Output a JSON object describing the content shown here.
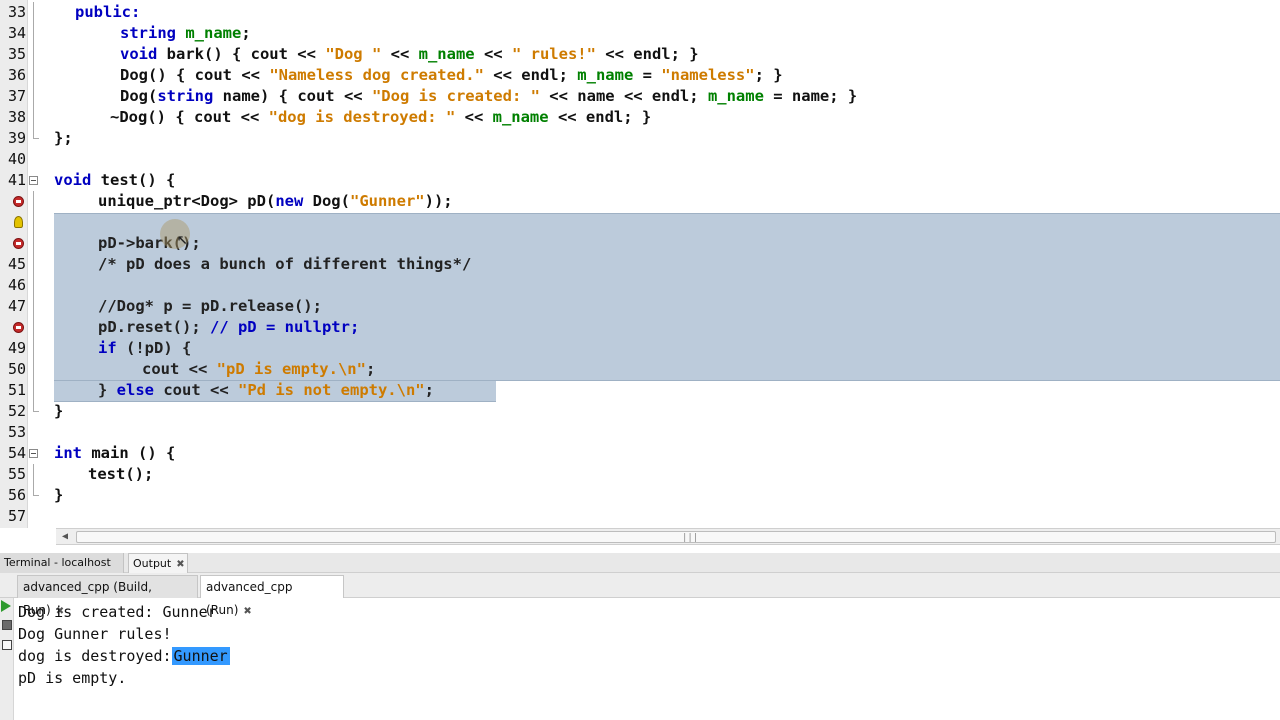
{
  "editor": {
    "lines": [
      {
        "n": "33",
        "text": "public:"
      },
      {
        "n": "34",
        "text": "string m_name;"
      },
      {
        "n": "35",
        "text": "void bark() { cout << \"Dog \" << m_name << \" rules!\" << endl; }"
      },
      {
        "n": "36",
        "text": "Dog() { cout << \"Nameless dog created.\" << endl; m_name = \"nameless\"; }"
      },
      {
        "n": "37",
        "text": "Dog(string name) { cout << \"Dog is created: \" << name << endl; m_name = name; }"
      },
      {
        "n": "38",
        "text": "~Dog() { cout << \"dog is destroyed: \" << m_name << endl; }"
      },
      {
        "n": "39",
        "text": "};"
      },
      {
        "n": "40",
        "text": ""
      },
      {
        "n": "41",
        "text": "void test() {"
      },
      {
        "n": "",
        "text": "unique_ptr<Dog> pD(new Dog(\"Gunner\"));"
      },
      {
        "n": "",
        "text": ""
      },
      {
        "n": "",
        "text": "pD->bark();"
      },
      {
        "n": "45",
        "text": "/* pD does a bunch of different things*/"
      },
      {
        "n": "46",
        "text": ""
      },
      {
        "n": "47",
        "text": "//Dog* p = pD.release();"
      },
      {
        "n": "",
        "text": "pD.reset(); // pD = nullptr;"
      },
      {
        "n": "49",
        "text": "if (!pD) {"
      },
      {
        "n": "50",
        "text": "cout << \"pD is empty.\\n\";"
      },
      {
        "n": "51",
        "text": "} else cout << \"Pd is not empty.\\n\";"
      },
      {
        "n": "52",
        "text": "}"
      },
      {
        "n": "53",
        "text": ""
      },
      {
        "n": "54",
        "text": "int main () {"
      },
      {
        "n": "55",
        "text": "test();"
      },
      {
        "n": "56",
        "text": "}"
      },
      {
        "n": "57",
        "text": ""
      }
    ]
  },
  "panel": {
    "tabs": [
      "Terminal - localhost",
      "Output"
    ],
    "subtabs": [
      "advanced_cpp (Build, Run)",
      "advanced_cpp (Run)"
    ]
  },
  "output": {
    "lines": [
      "Dog is created: Gunner",
      "Dog Gunner rules!",
      "dog is destroyed:",
      "pD is empty."
    ],
    "highlight": "Gunner"
  },
  "colors": {
    "selection": "#bccbdb",
    "keyword": "#0000c0",
    "identifier": "#008000",
    "string": "#ce7b00",
    "output_highlight": "#3399ff"
  }
}
